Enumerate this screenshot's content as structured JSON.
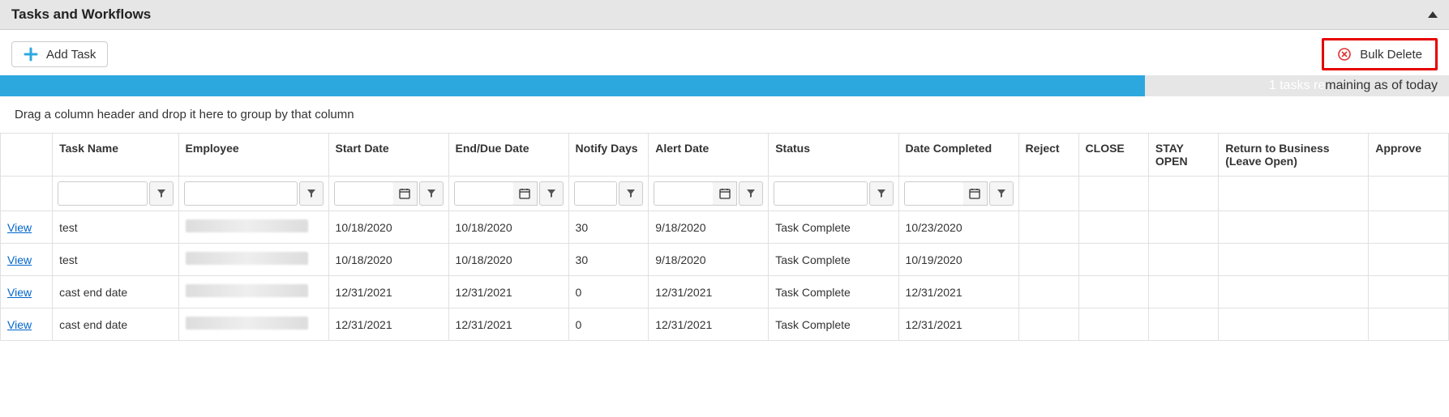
{
  "panel": {
    "title": "Tasks and Workflows"
  },
  "toolbar": {
    "add_task_label": "Add Task",
    "bulk_delete_label": "Bulk Delete"
  },
  "status": {
    "prefix": "1 tasks re",
    "suffix": "maining as of today"
  },
  "group_hint": "Drag a column header and drop it here to group by that column",
  "columns": {
    "view": "",
    "task_name": "Task Name",
    "employee": "Employee",
    "start_date": "Start Date",
    "end_date": "End/Due Date",
    "notify_days": "Notify Days",
    "alert_date": "Alert Date",
    "status": "Status",
    "date_completed": "Date Completed",
    "reject": "Reject",
    "close": "CLOSE",
    "stay_open": "STAY OPEN",
    "return_biz": "Return to Business (Leave Open)",
    "approve": "Approve"
  },
  "view_label": "View",
  "rows": [
    {
      "task_name": "test",
      "employee": "[redacted]",
      "start_date": "10/18/2020",
      "end_date": "10/18/2020",
      "notify_days": "30",
      "alert_date": "9/18/2020",
      "status": "Task Complete",
      "date_completed": "10/23/2020"
    },
    {
      "task_name": "test",
      "employee": "[redacted]",
      "start_date": "10/18/2020",
      "end_date": "10/18/2020",
      "notify_days": "30",
      "alert_date": "9/18/2020",
      "status": "Task Complete",
      "date_completed": "10/19/2020"
    },
    {
      "task_name": "cast end date",
      "employee": "[redacted]",
      "start_date": "12/31/2021",
      "end_date": "12/31/2021",
      "notify_days": "0",
      "alert_date": "12/31/2021",
      "status": "Task Complete",
      "date_completed": "12/31/2021"
    },
    {
      "task_name": "cast end date",
      "employee": "[redacted]",
      "start_date": "12/31/2021",
      "end_date": "12/31/2021",
      "notify_days": "0",
      "alert_date": "12/31/2021",
      "status": "Task Complete",
      "date_completed": "12/31/2021"
    }
  ]
}
